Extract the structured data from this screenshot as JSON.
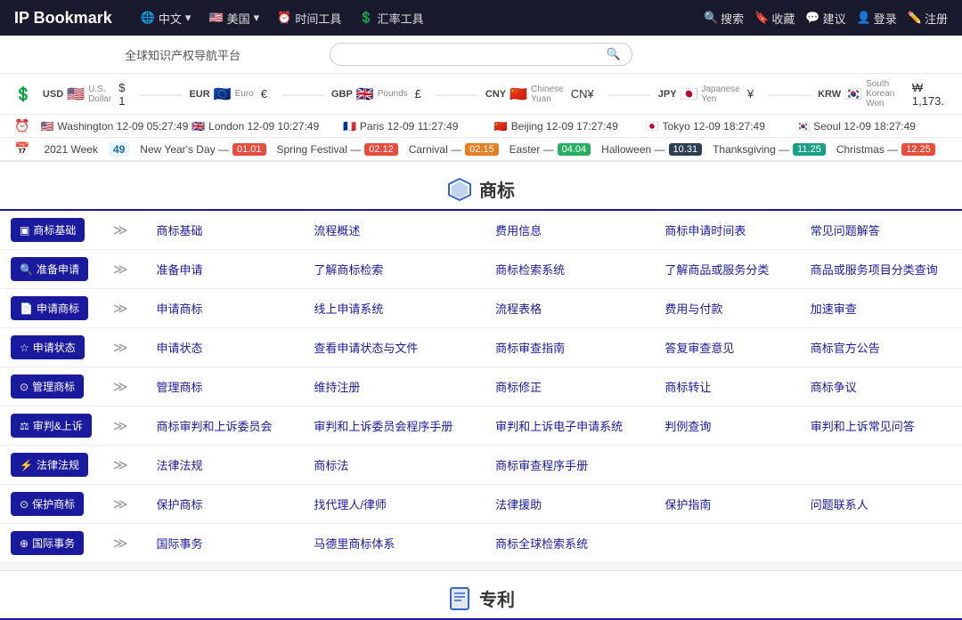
{
  "logo": "IP Bookmark",
  "nav": {
    "items": [
      {
        "label": "中文",
        "icon": "🌐",
        "arrow": "▾"
      },
      {
        "label": "美国",
        "icon": "🇺🇸",
        "arrow": "▾"
      },
      {
        "label": "时间工具",
        "icon": "⏰"
      },
      {
        "label": "汇率工具",
        "icon": "💲"
      }
    ],
    "actions": [
      {
        "icon": "🔍",
        "label": "搜索"
      },
      {
        "icon": "🔖",
        "label": "收藏"
      },
      {
        "icon": "💬",
        "label": "建议"
      },
      {
        "icon": "👤",
        "label": "登录"
      },
      {
        "icon": "✏️",
        "label": "注册"
      }
    ]
  },
  "platform_title": "全球知识产权导航平台",
  "search_placeholder": "",
  "currencies": [
    {
      "name": "USD",
      "sub": "U.S. Dollar",
      "flag": "🇺🇸",
      "symbol": "$",
      "value": "1",
      "line": true
    },
    {
      "name": "EUR",
      "sub": "Euro",
      "flag": "🇪🇺",
      "symbol": "€",
      "value": "",
      "line": true
    },
    {
      "name": "GBP",
      "sub": "Pounds",
      "flag": "🇬🇧",
      "symbol": "£",
      "value": "",
      "line": true
    },
    {
      "name": "CNY",
      "sub": "Chinese Yuan",
      "flag": "🇨🇳",
      "symbol": "CN¥",
      "value": "",
      "line": true
    },
    {
      "name": "JPY",
      "sub": "Japanese Yen",
      "flag": "🇯🇵",
      "symbol": "¥",
      "value": "",
      "line": true
    },
    {
      "name": "KRW",
      "sub": "South Korean Won",
      "flag": "🇰🇷",
      "symbol": "₩",
      "value": "1,173.",
      "line": false
    }
  ],
  "clocks": [
    {
      "flag": "🇺🇸",
      "city": "Washington",
      "time": "12-09 05:27:49"
    },
    {
      "flag": "🇬🇧",
      "city": "London",
      "time": "12-09 10:27:49"
    },
    {
      "flag": "🇫🇷",
      "city": "Paris",
      "time": "12-09 11:27:49"
    },
    {
      "flag": "🇨🇳",
      "city": "Beijing",
      "time": "12-09 17:27:49"
    },
    {
      "flag": "🇯🇵",
      "city": "Tokyo",
      "time": "12-09 18:27:49"
    },
    {
      "flag": "🇰🇷",
      "city": "Seoul",
      "time": "12-09 18:27:49"
    }
  ],
  "calendar": {
    "week_label": "2021 Week",
    "week_num": "49",
    "dates": [
      {
        "label": "New Year's Day —",
        "badge": "01.01",
        "color": "red"
      },
      {
        "label": "Spring Festival —",
        "badge": "02.12",
        "color": "red"
      },
      {
        "label": "Carnival —",
        "badge": "02.15",
        "color": "orange"
      },
      {
        "label": "Easter —",
        "badge": "04.04",
        "color": "green"
      },
      {
        "label": "Halloween —",
        "badge": "10.31",
        "color": "dark"
      },
      {
        "label": "Thanksgiving —",
        "badge": "11.25",
        "color": "teal"
      },
      {
        "label": "Christmas —",
        "badge": "12.25",
        "color": "red"
      }
    ]
  },
  "sections": [
    {
      "id": "trademark",
      "icon": "🔷",
      "title": "商标",
      "categories": [
        {
          "btn_icon": "▣",
          "btn_label": "商标基础",
          "links": [
            "商标基础",
            "流程概述",
            "费用信息",
            "商标申请时间表",
            "常见问题解答"
          ]
        },
        {
          "btn_icon": "🔍",
          "btn_label": "准备申请",
          "links": [
            "准备申请",
            "了解商标检索",
            "商标检索系统",
            "了解商品或服务分类",
            "商品或服务项目分类查询"
          ]
        },
        {
          "btn_icon": "📄",
          "btn_label": "申请商标",
          "links": [
            "申请商标",
            "线上申请系统",
            "流程表格",
            "费用与付款",
            "加速审查"
          ]
        },
        {
          "btn_icon": "☆",
          "btn_label": "申请状态",
          "links": [
            "申请状态",
            "查看申请状态与文件",
            "商标审查指南",
            "答复审查意见",
            "商标官方公告"
          ]
        },
        {
          "btn_icon": "⊙",
          "btn_label": "管理商标",
          "links": [
            "管理商标",
            "维持注册",
            "商标修正",
            "商标转让",
            "商标争议"
          ]
        },
        {
          "btn_icon": "⚖",
          "btn_label": "审判&上诉",
          "links": [
            "商标审判和上诉委员会",
            "审判和上诉委员会程序手册",
            "审判和上诉电子申请系统",
            "判例查询",
            "审判和上诉常见问答"
          ]
        },
        {
          "btn_icon": "⚡",
          "btn_label": "法律法规",
          "links": [
            "法律法规",
            "商标法",
            "商标审查程序手册",
            "",
            ""
          ]
        },
        {
          "btn_icon": "⊙",
          "btn_label": "保护商标",
          "links": [
            "保护商标",
            "找代理人/律师",
            "法律援助",
            "保护指南",
            "问题联系人"
          ]
        },
        {
          "btn_icon": "⊕",
          "btn_label": "国际事务",
          "links": [
            "国际事务",
            "马德里商标体系",
            "商标全球检索系统",
            "",
            ""
          ]
        }
      ]
    },
    {
      "id": "patent",
      "icon": "📋",
      "title": "专利",
      "categories": []
    }
  ]
}
